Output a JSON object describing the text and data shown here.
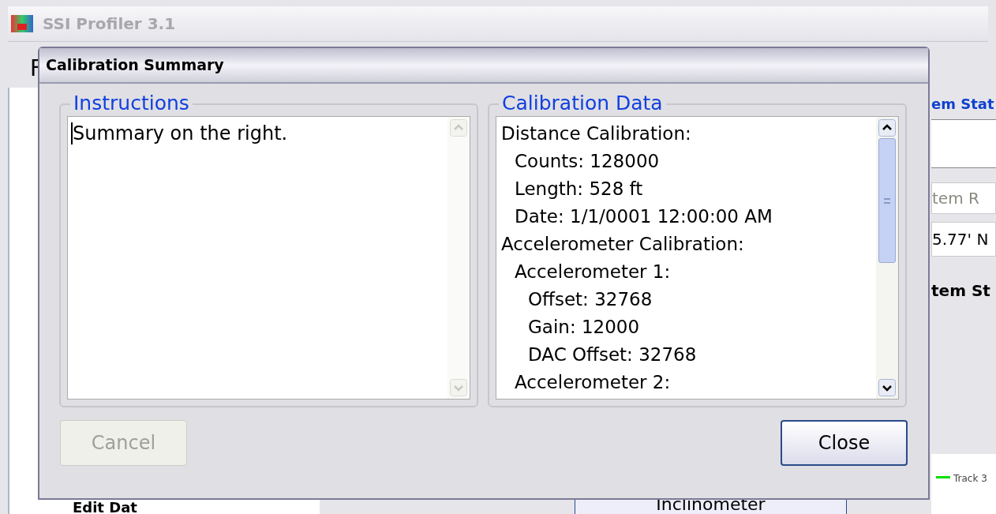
{
  "app_window": {
    "title": "SSI Profiler 3.1",
    "menu_text": "F",
    "side_item": "Edit Dat",
    "right_panel": {
      "heading": "em Stat",
      "field_1": "tem R",
      "field_2": "5.77' N",
      "label": "tem St",
      "legend": "Track 3",
      "button": "Inclinometer"
    }
  },
  "dialog": {
    "title": "Calibration Summary",
    "instructions": {
      "label": "Instructions",
      "text": "Summary on the right."
    },
    "calibration_data": {
      "label": "Calibration Data",
      "lines": [
        {
          "text": "Distance Calibration:",
          "children": [
            {
              "text": "Counts: 128000"
            },
            {
              "text": "Length: 528 ft"
            },
            {
              "text": "Date: 1/1/0001 12:00:00 AM"
            }
          ]
        },
        {
          "text": "Accelerometer Calibration:",
          "children": [
            {
              "text": "Accelerometer 1:",
              "children": [
                {
                  "text": "Offset: 32768"
                },
                {
                  "text": "Gain: 12000"
                },
                {
                  "text": "DAC Offset: 32768"
                }
              ]
            },
            {
              "text": "Accelerometer 2:"
            }
          ]
        }
      ]
    },
    "buttons": [
      {
        "label": "Cancel",
        "disabled": true
      },
      {
        "label": "Close",
        "disabled": false
      }
    ]
  }
}
